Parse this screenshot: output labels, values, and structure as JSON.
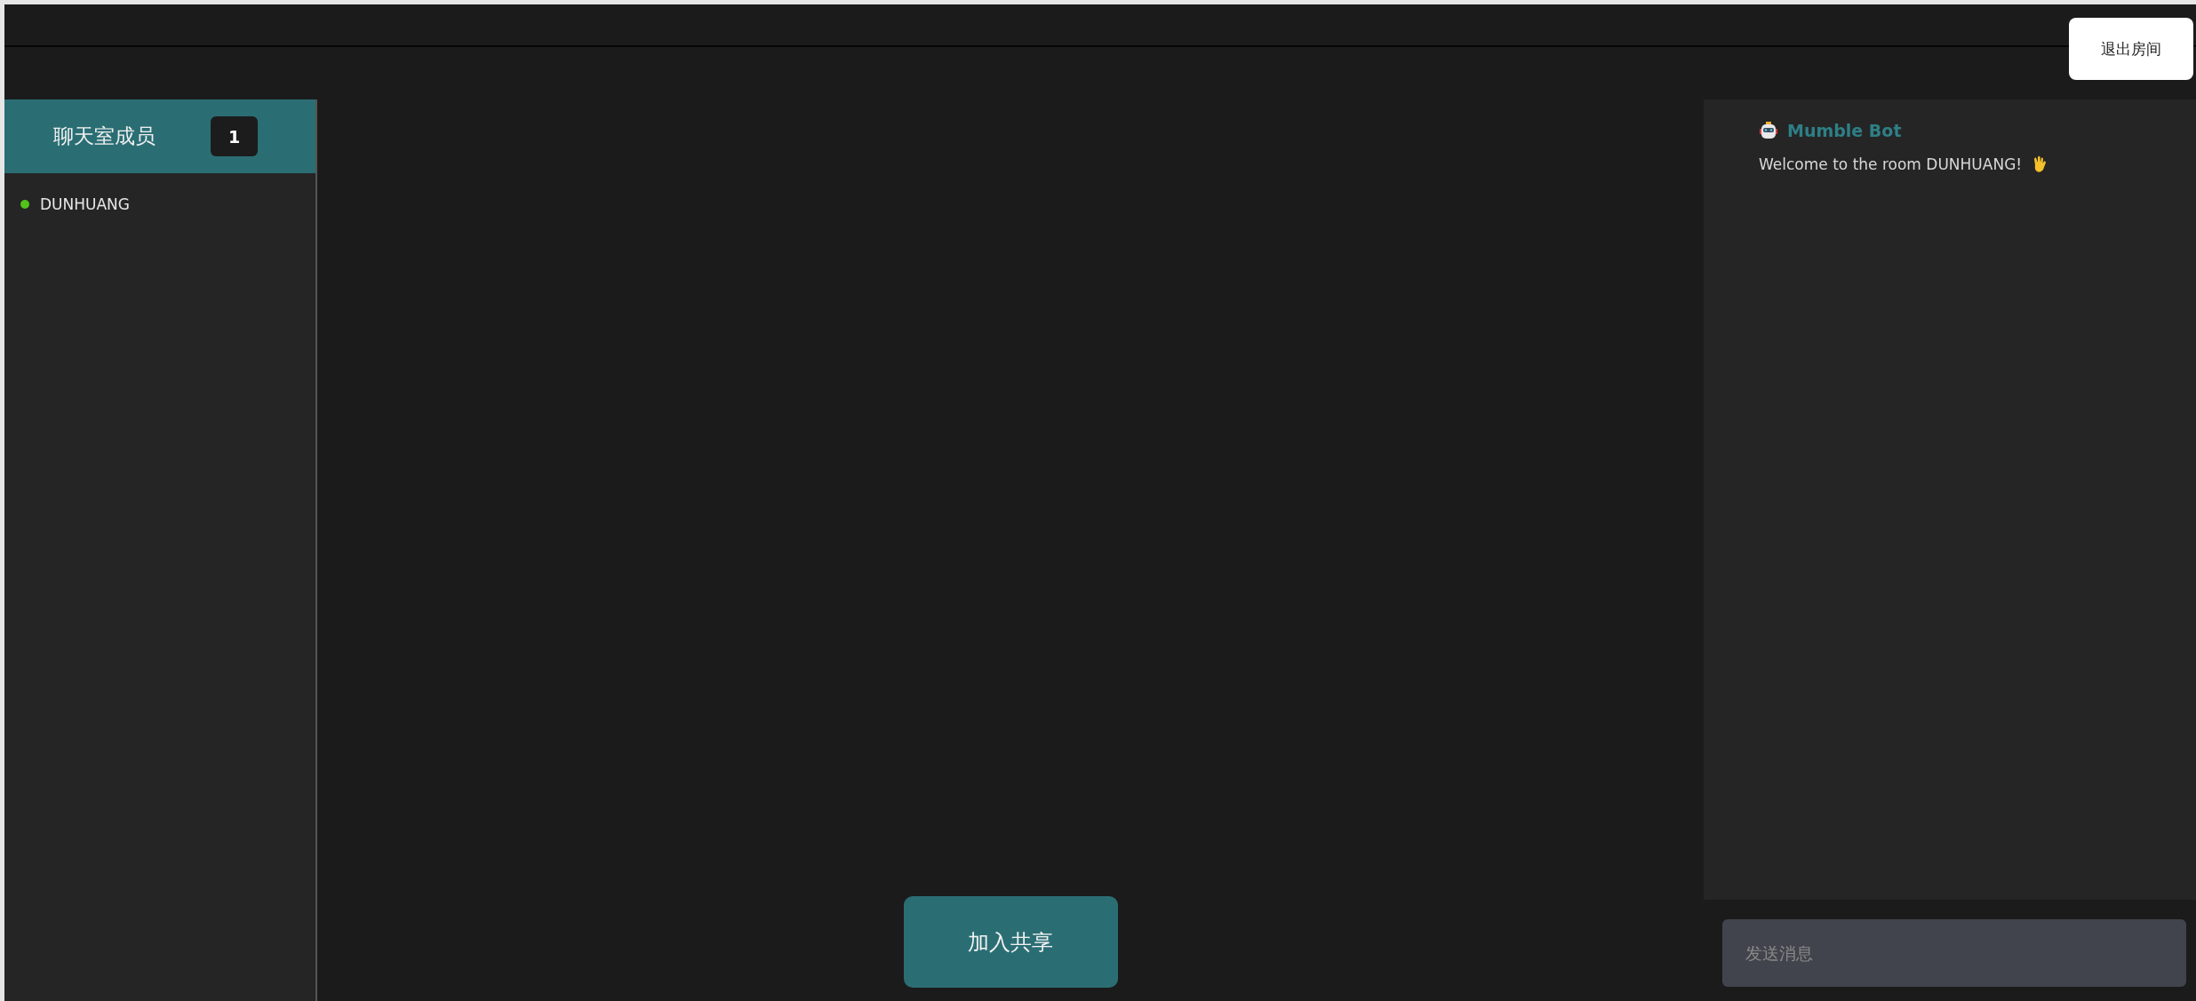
{
  "header": {
    "leave_button": "退出房间"
  },
  "sidebar": {
    "title": "聊天室成员",
    "count": "1",
    "members": [
      {
        "name": "DUNHUANG",
        "color": "#52c41a"
      }
    ]
  },
  "stage": {
    "join_button": "加入共享"
  },
  "chat": {
    "messages": [
      {
        "author": "Mumble Bot",
        "text": "Welcome to the room DUNHUANG!"
      }
    ],
    "input": {
      "placeholder": "发送消息"
    }
  }
}
